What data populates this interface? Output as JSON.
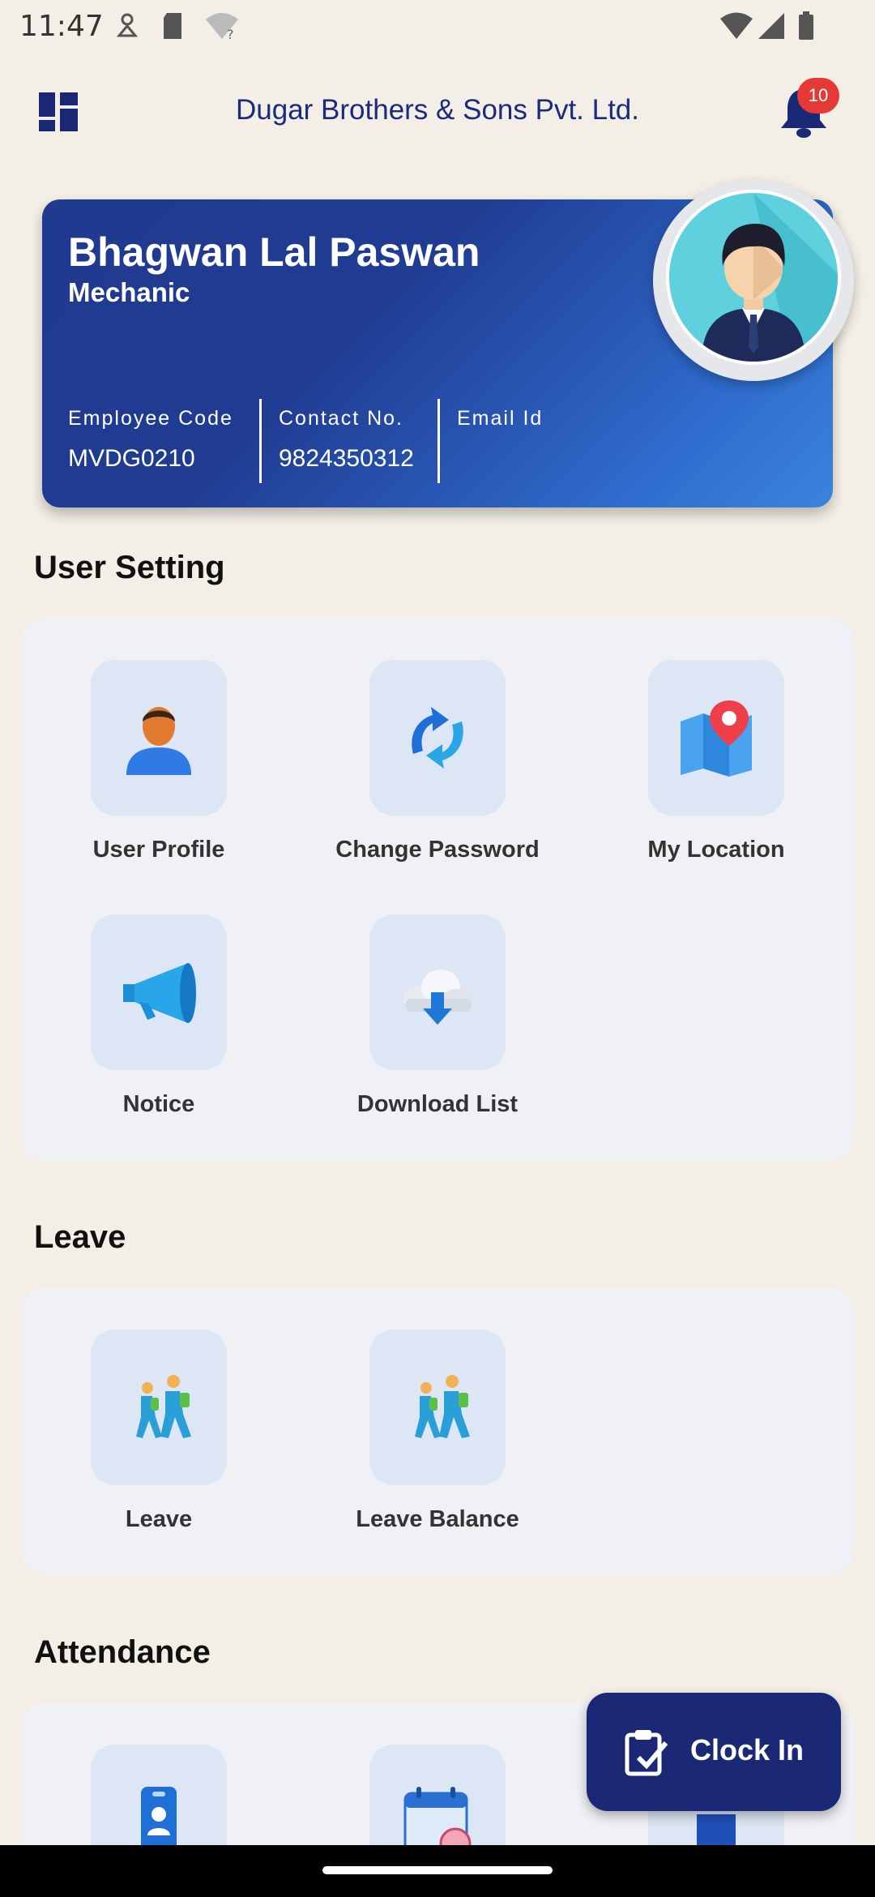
{
  "status": {
    "time": "11:47"
  },
  "header": {
    "title": "Dugar Brothers & Sons Pvt. Ltd.",
    "notification_count": "10"
  },
  "profile": {
    "name": "Bhagwan Lal Paswan",
    "role": "Mechanic",
    "fields": [
      {
        "label": "Employee Code",
        "value": "MVDG0210"
      },
      {
        "label": "Contact No.",
        "value": "9824350312"
      },
      {
        "label": "Email Id",
        "value": ""
      }
    ]
  },
  "sections": {
    "user_setting": {
      "title": "User Setting",
      "items": [
        {
          "label": "User Profile",
          "icon": "user-profile-icon"
        },
        {
          "label": "Change Password",
          "icon": "refresh-arrows-icon"
        },
        {
          "label": "My Location",
          "icon": "map-pin-icon"
        },
        {
          "label": "Notice",
          "icon": "megaphone-icon"
        },
        {
          "label": "Download List",
          "icon": "cloud-download-icon"
        }
      ]
    },
    "leave": {
      "title": "Leave",
      "items": [
        {
          "label": "Leave",
          "icon": "walking-people-icon"
        },
        {
          "label": "Leave Balance",
          "icon": "walking-people-icon"
        }
      ]
    },
    "attendance": {
      "title": "Attendance",
      "items": [
        {
          "icon": "id-badge-icon"
        },
        {
          "icon": "calendar-clock-icon"
        },
        {
          "icon": "building-icon"
        }
      ]
    }
  },
  "fab": {
    "label": "Clock In",
    "icon": "clipboard-check-icon"
  },
  "colors": {
    "primary": "#1a2876",
    "title": "#1a2a7c",
    "background": "#f3efe6",
    "panel": "#eff1f5",
    "tile": "#dde6f4",
    "badge": "#e53935"
  }
}
